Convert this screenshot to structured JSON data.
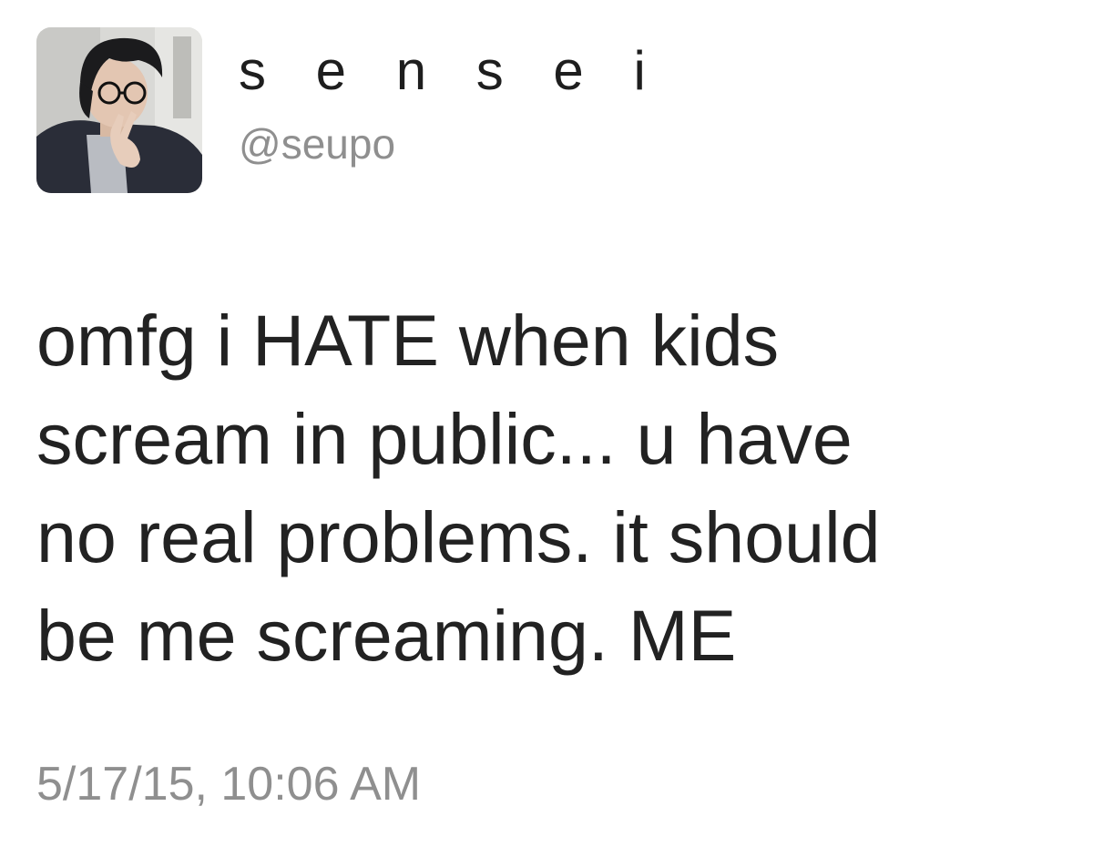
{
  "tweet": {
    "author": {
      "display_name": "s e n s e i",
      "handle": "@seupo",
      "avatar_icon": "profile-photo"
    },
    "text_lines": [
      "omfg i HATE when kids",
      "scream in public... u have",
      "no real problems. it should",
      "be me screaming. ME"
    ],
    "timestamp": "5/17/15, 10:06 AM"
  },
  "colors": {
    "text": "#222222",
    "secondary_text": "#8f8f8f",
    "background": "#ffffff"
  }
}
